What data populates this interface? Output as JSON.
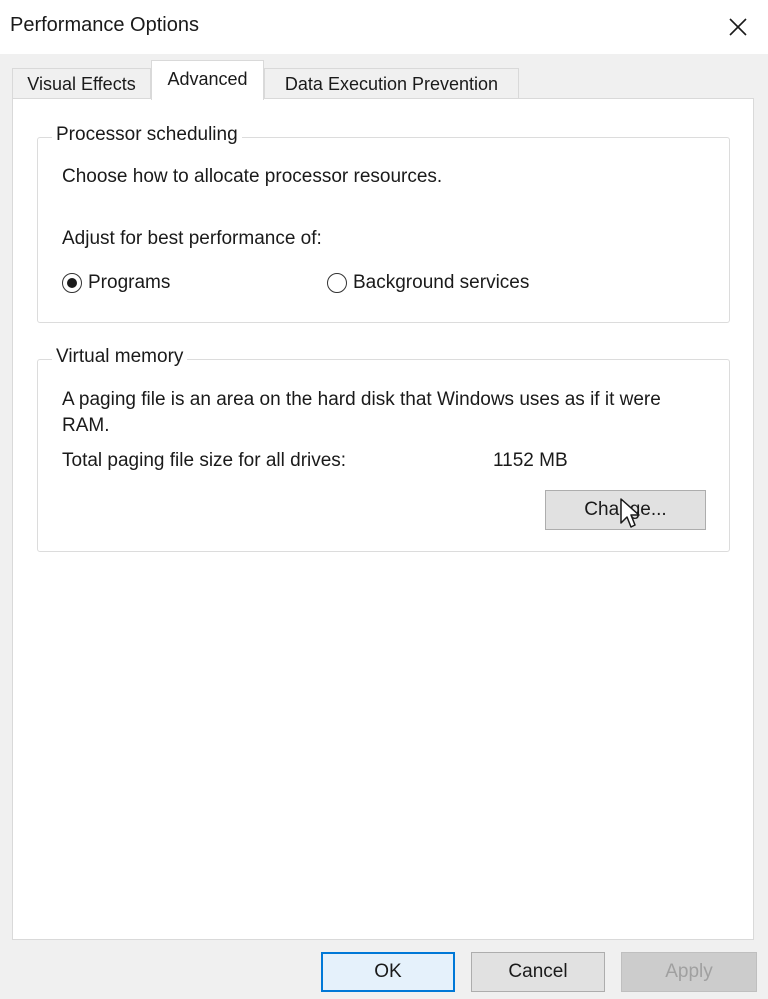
{
  "window": {
    "title": "Performance Options"
  },
  "tabs": [
    {
      "label": "Visual Effects",
      "active": false
    },
    {
      "label": "Advanced",
      "active": true
    },
    {
      "label": "Data Execution Prevention",
      "active": false
    }
  ],
  "processor_scheduling": {
    "legend": "Processor scheduling",
    "description": "Choose how to allocate processor resources.",
    "adjust_label": "Adjust for best performance of:",
    "options": [
      {
        "label": "Programs",
        "selected": true
      },
      {
        "label": "Background services",
        "selected": false
      }
    ]
  },
  "virtual_memory": {
    "legend": "Virtual memory",
    "description": "A paging file is an area on the hard disk that Windows uses as if it were RAM.",
    "total_label": "Total paging file size for all drives:",
    "total_value": "1152 MB",
    "change_button": "Change..."
  },
  "footer": {
    "ok_label": "OK",
    "cancel_label": "Cancel",
    "apply_label": "Apply"
  },
  "icons": {
    "close": "close-icon",
    "cursor": "mouse-pointer-icon"
  },
  "colors": {
    "accent": "#0078d7",
    "background": "#f0f0f0",
    "panel": "#ffffff"
  }
}
